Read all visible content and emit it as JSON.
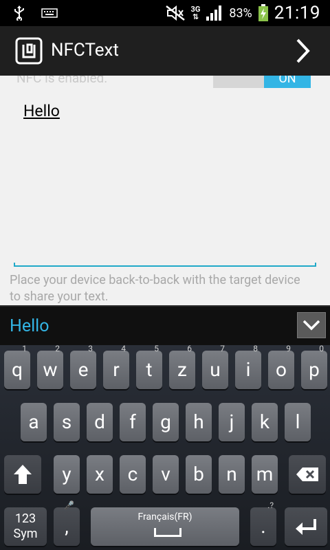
{
  "status_bar": {
    "battery_percent": "83%",
    "time": "21:19",
    "network": "3G"
  },
  "action_bar": {
    "title": "NFCText"
  },
  "content": {
    "nfc_status": "NFC is enabled.",
    "switch_label": "ON",
    "message": "Hello",
    "help_text": "Place your device back-to-back with the target device to share your text."
  },
  "suggestions": {
    "word": "Hello"
  },
  "keyboard": {
    "row1": [
      {
        "label": "q",
        "hint": "1"
      },
      {
        "label": "w",
        "hint": "2"
      },
      {
        "label": "e",
        "hint": "3"
      },
      {
        "label": "r",
        "hint": "4"
      },
      {
        "label": "t",
        "hint": "5"
      },
      {
        "label": "z",
        "hint": "6"
      },
      {
        "label": "u",
        "hint": "7"
      },
      {
        "label": "i",
        "hint": "8"
      },
      {
        "label": "o",
        "hint": "9"
      },
      {
        "label": "p",
        "hint": "0"
      }
    ],
    "row2": [
      "a",
      "s",
      "d",
      "f",
      "g",
      "h",
      "j",
      "k",
      "l"
    ],
    "row3": [
      "y",
      "x",
      "c",
      "v",
      "b",
      "n",
      "m"
    ],
    "sym_label_top": "123",
    "sym_label_bottom": "Sym",
    "comma": ",",
    "period": ".",
    "space_label": "Français(FR)"
  }
}
